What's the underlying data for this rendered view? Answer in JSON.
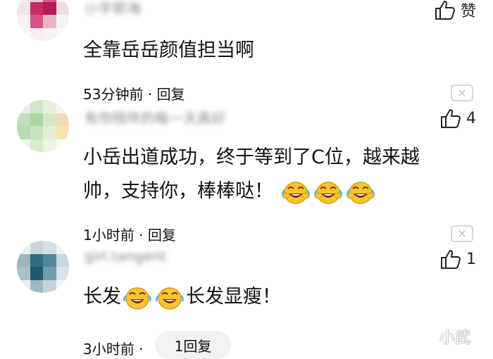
{
  "comments": [
    {
      "username": "小宇即海",
      "text": "全靠岳岳颜值担当啊",
      "like_label": "赞"
    },
    {
      "time": "53分钟前",
      "reply_label": "回复",
      "username": "有你陪伴的每一天真好",
      "text_line1": "小岳出道成功，终于等到了C位，越来越",
      "text_line2": "帅，支持你，棒棒哒！",
      "likes": "4"
    },
    {
      "time": "1小时前",
      "reply_label": "回复",
      "username": "girl.tangent",
      "text_part1": "长发",
      "text_part2": "长发显瘦！",
      "likes": "1"
    },
    {
      "time": "3小时前",
      "reply_count_label": "1回复"
    }
  ],
  "separator": " · ",
  "close_icon": "×",
  "watermark": "小武",
  "icons": [
    "thumbs-up-icon",
    "close-icon",
    "laughing-emoji-icon"
  ]
}
